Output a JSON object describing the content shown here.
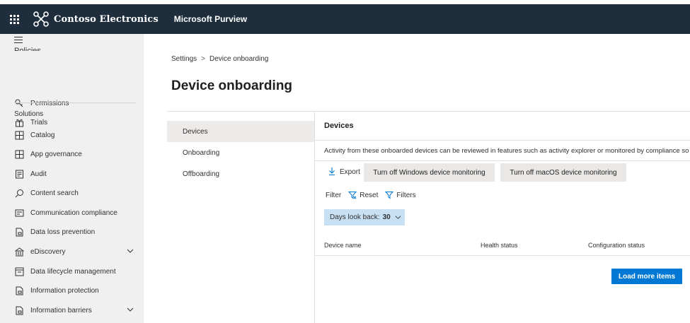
{
  "topbar": {
    "org_name": "Contoso Electronics",
    "app_name": "Microsoft Purview"
  },
  "leftnav": {
    "partial_item": "Policies",
    "items_top": [
      {
        "label": "Permissions",
        "icon": "key-icon"
      },
      {
        "label": "Trials",
        "icon": "gift-icon"
      }
    ],
    "section_title": "Solutions",
    "solutions": [
      {
        "label": "Catalog",
        "icon": "catalog-icon",
        "expandable": false
      },
      {
        "label": "App governance",
        "icon": "app-governance-icon",
        "expandable": false
      },
      {
        "label": "Audit",
        "icon": "audit-icon",
        "expandable": false
      },
      {
        "label": "Content search",
        "icon": "search-icon",
        "expandable": false
      },
      {
        "label": "Communication compliance",
        "icon": "communication-icon",
        "expandable": false
      },
      {
        "label": "Data loss prevention",
        "icon": "dlp-icon",
        "expandable": false
      },
      {
        "label": "eDiscovery",
        "icon": "ediscovery-icon",
        "expandable": true
      },
      {
        "label": "Data lifecycle management",
        "icon": "lifecycle-icon",
        "expandable": false
      },
      {
        "label": "Information protection",
        "icon": "info-protection-icon",
        "expandable": false
      },
      {
        "label": "Information barriers",
        "icon": "info-barriers-icon",
        "expandable": true
      }
    ]
  },
  "breadcrumb": {
    "parent": "Settings",
    "separator": ">",
    "current": "Device onboarding"
  },
  "page_title": "Device onboarding",
  "tabs": [
    {
      "label": "Devices",
      "active": true
    },
    {
      "label": "Onboarding",
      "active": false
    },
    {
      "label": "Offboarding",
      "active": false
    }
  ],
  "devices_panel": {
    "title": "Devices",
    "description": "Activity from these onboarded devices can be reviewed in features such as activity explorer or monitored by compliance so",
    "export_label": "Export",
    "btn_windows": "Turn off Windows device monitoring",
    "btn_mac": "Turn off macOS device monitoring",
    "filter_label": "Filter",
    "reset_label": "Reset",
    "filters_label": "Filters",
    "days_label": "Days look back:",
    "days_value": "30",
    "columns": [
      "Device name",
      "Health status",
      "Configuration status"
    ],
    "load_more": "Load more items"
  },
  "colors": {
    "topbar_bg": "#1f2e3d",
    "nav_bg": "#f0f0f0",
    "primary": "#0078d4",
    "days_bg": "#c7e0f4"
  }
}
